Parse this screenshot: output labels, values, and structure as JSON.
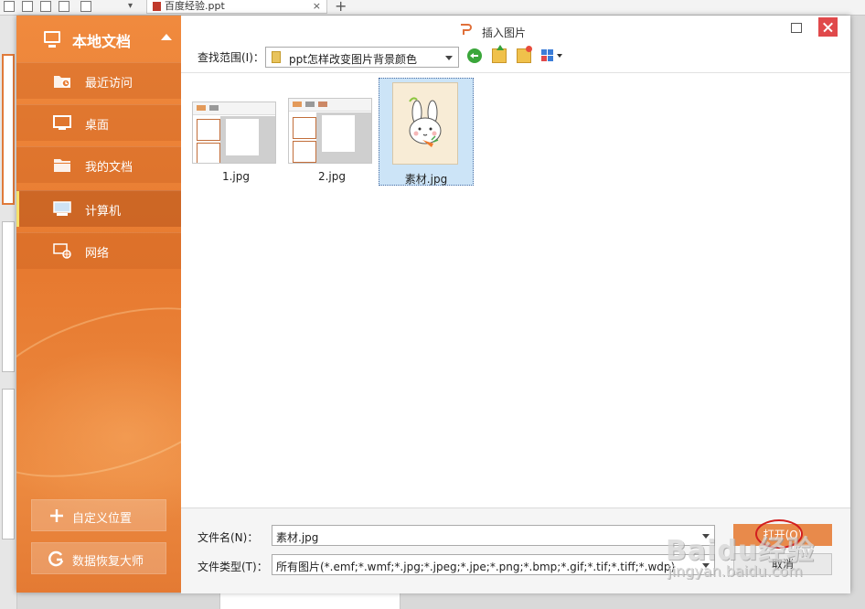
{
  "background": {
    "tab_title": "百度经验.ppt"
  },
  "dialog": {
    "title": "插入图片",
    "sidebar": {
      "header": "本地文档",
      "items": [
        {
          "label": "最近访问",
          "icon": "recent-folder-icon"
        },
        {
          "label": "桌面",
          "icon": "desktop-icon"
        },
        {
          "label": "我的文档",
          "icon": "documents-folder-icon"
        },
        {
          "label": "计算机",
          "icon": "computer-icon",
          "active": true
        },
        {
          "label": "网络",
          "icon": "network-icon"
        }
      ],
      "custom_location": "自定义位置",
      "data_recovery": "数据恢复大师"
    },
    "lookin": {
      "label": "查找范围(I)：",
      "value": "ppt怎样改变图片背景颜色"
    },
    "files": [
      {
        "name": "1.jpg"
      },
      {
        "name": "2.jpg"
      },
      {
        "name": "素材.jpg",
        "selected": true
      }
    ],
    "filename": {
      "label": "文件名(N)：",
      "value": "素材.jpg"
    },
    "filetype": {
      "label": "文件类型(T)：",
      "value": "所有图片(*.emf;*.wmf;*.jpg;*.jpeg;*.jpe;*.png;*.bmp;*.gif;*.tif;*.tiff;*.wdp)"
    },
    "open_button": "打开(O)",
    "cancel_button": "取消"
  },
  "watermark": {
    "brand": "Baidu经验",
    "url": "jingyan.baidu.com"
  },
  "colors": {
    "sidebar_orange": "#e77a30",
    "open_button": "#e88a4b",
    "close_button": "#e0494b",
    "selection": "#cce4f7",
    "highlight_ring": "#d21f1f"
  }
}
